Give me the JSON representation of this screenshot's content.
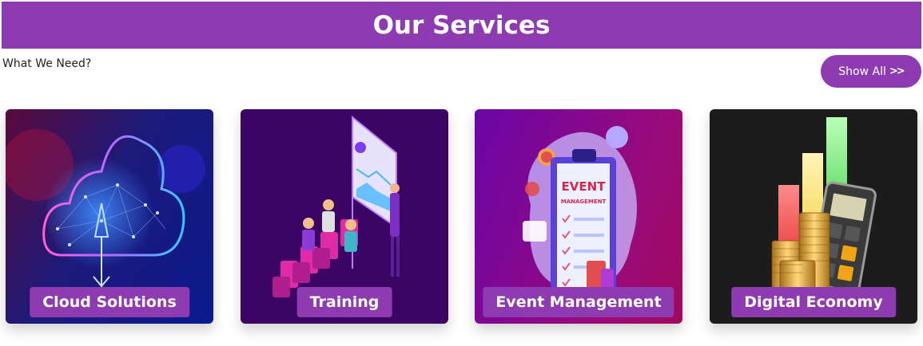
{
  "header": {
    "title": "Our Services"
  },
  "subtitle": "What We Need?",
  "show_all": {
    "label": "Show All",
    "chevron": ">>"
  },
  "services": [
    {
      "label": "Cloud Solutions",
      "icon": "cloud-upload-icon"
    },
    {
      "label": "Training",
      "icon": "presentation-icon"
    },
    {
      "label": "Event Management",
      "icon": "clipboard-icon"
    },
    {
      "label": "Digital Economy",
      "icon": "calculator-coins-icon"
    }
  ],
  "event_board": {
    "line1": "EVENT",
    "line2": "MANAGEMENT"
  },
  "colors": {
    "brand": "#8e3bb2"
  }
}
